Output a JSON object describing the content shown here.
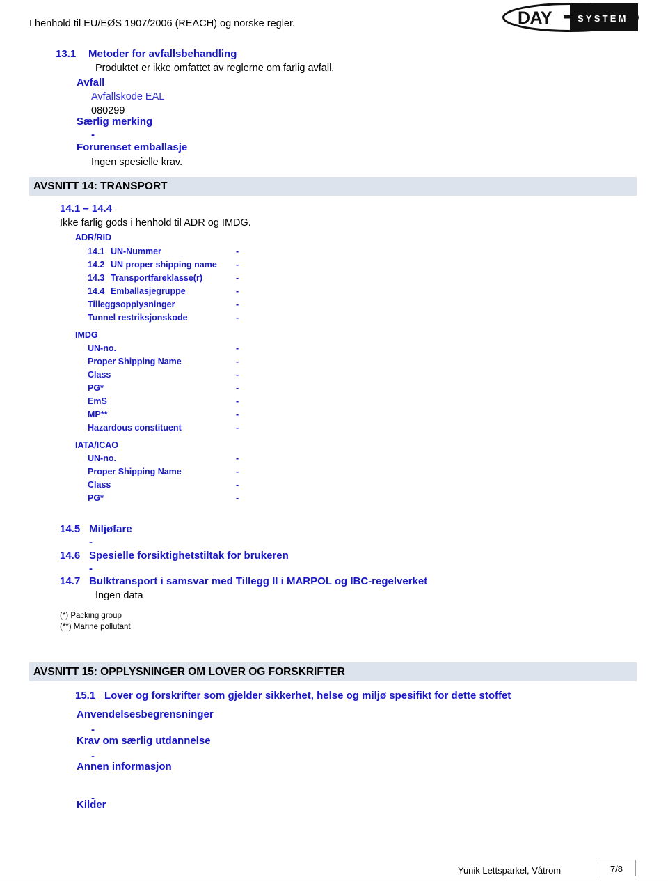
{
  "header": {
    "compliance_text": "I henhold til EU/EØS 1907/2006 (REACH) og norske regler.",
    "logo": {
      "name": "day-system-logo",
      "left_text": "DAY",
      "separator": "-",
      "right_text": "S Y S T E M"
    }
  },
  "section13": {
    "item_number": "13.1",
    "item_title": "Metoder for avfallsbehandling",
    "item_body": "Produktet er ikke omfattet av reglerne om farlig avfall.",
    "avfall_heading": "Avfall",
    "avfallskode_label": "Avfallskode EAL",
    "avfallskode_value": "080299",
    "saerlig_merking_heading": "Særlig merking",
    "saerlig_merking_value": "-",
    "forurenset_heading": "Forurenset emballasje",
    "forurenset_value": "Ingen spesielle krav."
  },
  "section14": {
    "band_title": "AVSNITT 14:  TRANSPORT",
    "range_label": "14.1 – 14.4",
    "range_body": "Ikke farlig gods i henhold til ADR og IMDG.",
    "adr_rid": {
      "group_label": "ADR/RID",
      "rows": [
        {
          "num": "14.1",
          "key": "UN-Nummer",
          "value": "-"
        },
        {
          "num": "14.2",
          "key": "UN proper shipping name",
          "value": "-"
        },
        {
          "num": "14.3",
          "key": "Transportfareklasse(r)",
          "value": "-"
        },
        {
          "num": "14.4",
          "key": "Emballasjegruppe",
          "value": "-"
        },
        {
          "num": "",
          "key": "Tilleggsopplysninger",
          "value": "-"
        },
        {
          "num": "",
          "key": "Tunnel restriksjonskode",
          "value": "-"
        }
      ]
    },
    "imdg": {
      "group_label": "IMDG",
      "rows": [
        {
          "key": "UN-no.",
          "value": "-"
        },
        {
          "key": "Proper Shipping Name",
          "value": "-"
        },
        {
          "key": "Class",
          "value": "-"
        },
        {
          "key": "PG*",
          "value": "-"
        },
        {
          "key": "EmS",
          "value": "-"
        },
        {
          "key": "MP**",
          "value": "-"
        },
        {
          "key": "Hazardous constituent",
          "value": "-"
        }
      ]
    },
    "iata_icao": {
      "group_label": "IATA/ICAO",
      "rows": [
        {
          "key": "UN-no.",
          "value": "-"
        },
        {
          "key": "Proper Shipping Name",
          "value": "-"
        },
        {
          "key": "Class",
          "value": "-"
        },
        {
          "key": "PG*",
          "value": "-"
        }
      ]
    },
    "item_14_5": {
      "num": "14.5",
      "title": "Miljøfare",
      "value": "-"
    },
    "item_14_6": {
      "num": "14.6",
      "title": "Spesielle forsiktighetstiltak for brukeren",
      "value": "-"
    },
    "item_14_7": {
      "num": "14.7",
      "title": "Bulktransport i samsvar med Tillegg II i MARPOL og IBC-regelverket",
      "value": "Ingen data"
    },
    "footnote_1": "(*) Packing group",
    "footnote_2": "(**) Marine pollutant"
  },
  "section15": {
    "band_title": "AVSNITT 15:  OPPLYSNINGER OM LOVER OG FORSKRIFTER",
    "item_number": "15.1",
    "item_title": "Lover og forskrifter som gjelder sikkerhet, helse og miljø spesifikt for dette stoffet",
    "anvendelse_heading": "Anvendelsesbegrensninger",
    "anvendelse_value": "-",
    "krav_heading": "Krav om særlig utdannelse",
    "krav_value": "-",
    "annen_heading": "Annen informasjon",
    "annen_value": "-",
    "kilder_heading": "Kilder"
  },
  "footer": {
    "product_name": "Yunik Lettsparkel, Våtrom",
    "page_number": "7/8"
  },
  "colors": {
    "blue": "#1818c8",
    "band": "#dde3ec",
    "rule": "#9a9a9a"
  }
}
